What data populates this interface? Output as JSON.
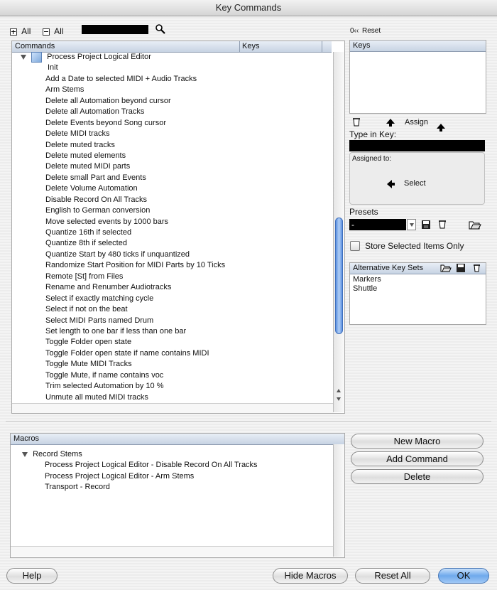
{
  "window": {
    "title": "Key Commands"
  },
  "filter": {
    "expand_all_label": "All",
    "collapse_all_label": "All"
  },
  "reset": {
    "label": "Reset"
  },
  "commands": {
    "column_commands": "Commands",
    "column_keys": "Keys",
    "folder": "Process Project Logical Editor",
    "items": [
      "Init",
      "Add  a Date to selected MIDI + Audio Tracks",
      "Arm Stems",
      "Delete all Automation beyond cursor",
      "Delete all Automation Tracks",
      "Delete Events beyond Song cursor",
      "Delete MIDI tracks",
      "Delete muted  tracks",
      "Delete muted elements",
      "Delete muted MIDI parts",
      "Delete small Part and Events",
      "Delete Volume Automation",
      "Disable Record On All Tracks",
      "English to German conversion",
      "Move selected events by 1000 bars",
      "Quantize 16th if selected",
      "Quantize 8th if selected",
      "Quantize Start by 480 ticks if unquantized",
      "Randomize Start Position for MIDI Parts by 10 Ticks",
      "Remote [St] from Files",
      "Rename and Renumber Audiotracks",
      "Select if exactly matching cycle",
      "Select if not on the beat",
      "Select MIDI Parts named Drum",
      "Set length to one bar  if less than one bar",
      "Toggle Folder open state",
      "Toggle Folder open state if name contains MIDI",
      "Toggle Mute MIDI Tracks",
      "Toggle Mute, if name contains voc",
      "Trim  selected Automation by 10 %",
      "Unmute all muted MIDI tracks"
    ]
  },
  "keys_panel": {
    "header": "Keys"
  },
  "assign": {
    "label": "Assign"
  },
  "type_in_key": {
    "label": "Type in Key:"
  },
  "assigned_to": {
    "label": "Assigned to:",
    "select_label": "Select"
  },
  "presets": {
    "label": "Presets",
    "value": "-"
  },
  "store_selected": {
    "label": "Store Selected Items Only"
  },
  "alt_key_sets": {
    "header": "Alternative Key Sets",
    "items": [
      "Markers",
      "Shuttle"
    ]
  },
  "macros": {
    "header": "Macros",
    "folder": "Record Stems",
    "items": [
      "Process Project Logical Editor - Disable Record On All Tracks",
      "Process Project Logical Editor - Arm Stems",
      "Transport - Record"
    ]
  },
  "macro_buttons": {
    "new_macro": "New Macro",
    "add_command": "Add Command",
    "delete": "Delete"
  },
  "footer": {
    "help": "Help",
    "hide_macros": "Hide Macros",
    "reset_all": "Reset All",
    "ok": "OK"
  }
}
